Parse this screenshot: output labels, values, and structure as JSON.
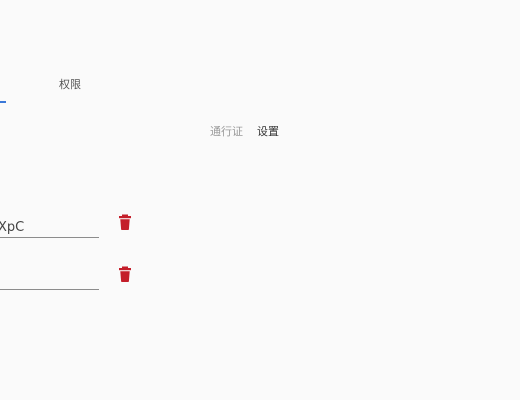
{
  "tabs": [
    {
      "label": "",
      "active": true
    },
    {
      "label": "权限",
      "active": false
    }
  ],
  "subtabs": [
    {
      "label": "通行证",
      "active": false
    },
    {
      "label": "设置",
      "active": true
    }
  ],
  "fields": [
    {
      "value": "XpC"
    },
    {
      "value": ""
    }
  ],
  "icons": {
    "delete": "trash-icon"
  },
  "colors": {
    "accent": "#3a78d8",
    "delete": "#c41e2a"
  }
}
